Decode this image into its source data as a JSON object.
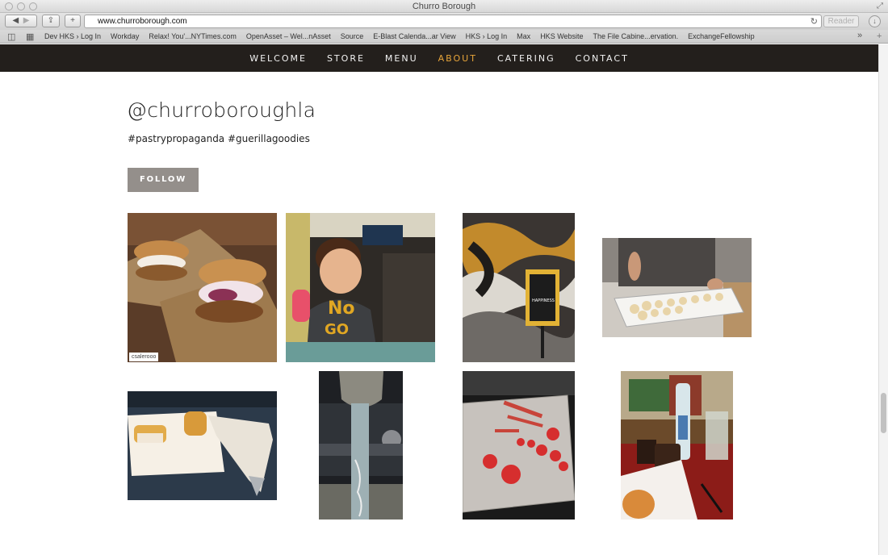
{
  "browser": {
    "window_title": "Churro Borough",
    "url": "www.churroborough.com",
    "reader_label": "Reader",
    "bookmarks": [
      "Dev HKS › Log In",
      "Workday",
      "Relax! You'...NYTimes.com",
      "OpenAsset – Wel...nAsset",
      "Source",
      "E-Blast Calenda...ar View",
      "HKS › Log In",
      "Max",
      "HKS Website",
      "The File Cabine...ervation.",
      "ExchangeFellowship"
    ]
  },
  "nav": {
    "items": [
      "WELCOME",
      "STORE",
      "MENU",
      "ABOUT",
      "CATERING",
      "CONTACT"
    ],
    "active": "ABOUT",
    "active_color": "#e6a43a",
    "bg_color": "#231f1c"
  },
  "instagram": {
    "handle": "@churroboroughla",
    "tags": "#pastrypropaganda #guerillagoodies",
    "follow_label": "FOLLOW",
    "photos": [
      {
        "subject": "ice cream sandwiches in paper trays",
        "credit": "csalerooo"
      },
      {
        "subject": "child holding pink popsicle"
      },
      {
        "subject": "happiness sign with swirl art"
      },
      {
        "subject": "tray of churro pinwheels"
      },
      {
        "subject": "pastry with piping bag"
      },
      {
        "subject": "parking meter and car"
      },
      {
        "subject": "tray of strawberries and rhubarb"
      },
      {
        "subject": "coffee and pastry on table"
      }
    ]
  }
}
